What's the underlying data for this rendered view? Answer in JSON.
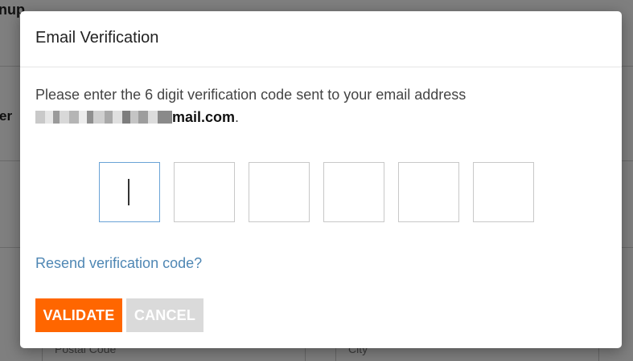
{
  "background": {
    "title_fragment": "nup",
    "label_fragment": "er",
    "postal_code_placeholder": "Postal Code",
    "city_placeholder": "City"
  },
  "dialog": {
    "title": "Email Verification",
    "message_prefix": "Please enter the 6 digit verification code sent to your email address",
    "email_visible_domain": "mail.com",
    "message_suffix": ".",
    "code_digits": [
      "",
      "",
      "",
      "",
      "",
      ""
    ],
    "resend_link": "Resend verification code?",
    "validate_label": "VALIDATE",
    "cancel_label": "CANCEL"
  },
  "colors": {
    "accent": "#ff6600",
    "link": "#4f87b4",
    "active_input_border": "#6aa3d6",
    "cancel_bg": "#dadada"
  }
}
